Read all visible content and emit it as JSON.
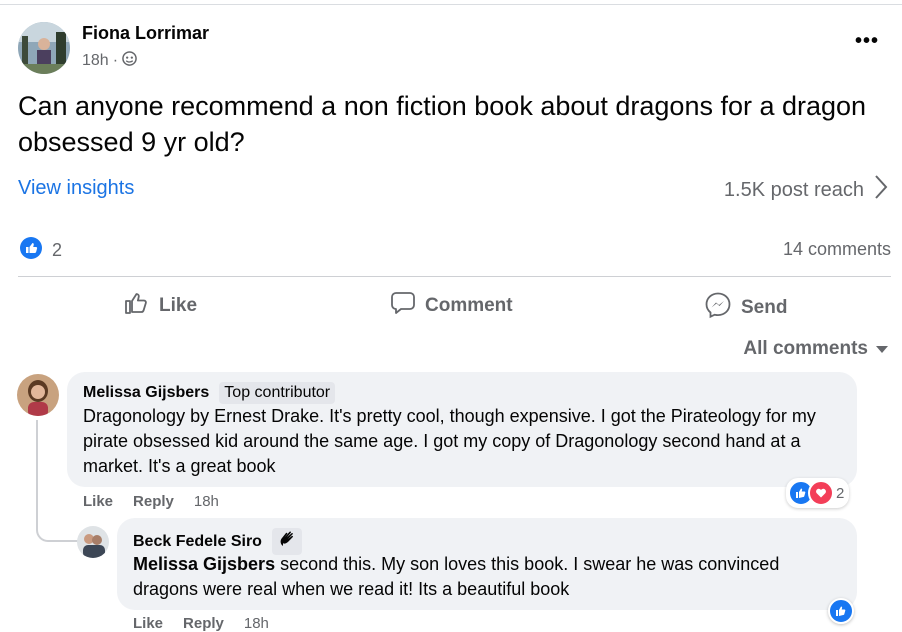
{
  "post": {
    "author": "Fiona Lorrimar",
    "time": "18h",
    "separator": "·",
    "text": "Can anyone recommend a non fiction book about dragons for a dragon obsessed 9 yr old?",
    "view_insights": "View insights",
    "reach": "1.5K post reach",
    "like_count": "2",
    "comments_count": "14 comments"
  },
  "actions": {
    "like": "Like",
    "comment": "Comment",
    "send": "Send"
  },
  "comments_sort": "All comments",
  "comments": [
    {
      "author": "Melissa Gijsbers",
      "badge": "Top contributor",
      "text": "Dragonology by Ernest Drake. It's pretty cool, though expensive. I got the Pirateology for my pirate obsessed kid around the same age. I got my copy of Dragonology second hand at a market. It's a great book",
      "like": "Like",
      "reply": "Reply",
      "time": "18h",
      "reaction_count": "2"
    },
    {
      "author": "Beck Fedele Siro",
      "mention": "Melissa Gijsbers",
      "text": " second this. My son loves this book. I swear he was convinced dragons were real when we read it! Its a beautiful book",
      "like": "Like",
      "reply": "Reply",
      "time": "18h"
    }
  ],
  "colors": {
    "accent": "#1b74e4",
    "like_blue": "#1877f2",
    "love_red": "#f33e58",
    "secondary_text": "#65676b",
    "bubble_bg": "#f0f2f5"
  },
  "icons": [
    "globe-icon",
    "more-icon",
    "chevron-right-icon",
    "like-reaction-icon",
    "thumbs-up-icon",
    "comment-icon",
    "messenger-icon",
    "dropdown-caret-icon",
    "love-reaction-icon",
    "new-member-wave-icon"
  ]
}
